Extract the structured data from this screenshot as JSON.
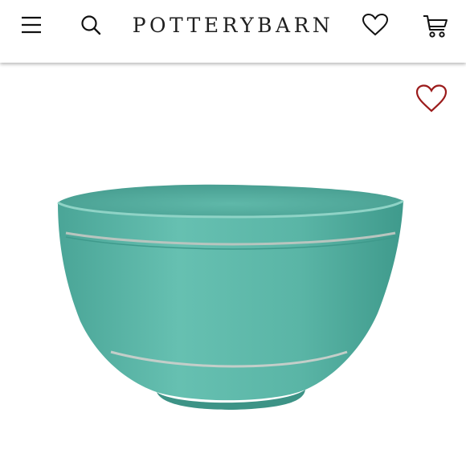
{
  "header": {
    "brand": "POTTERYBARN",
    "icons": {
      "menu": "hamburger-menu-icon",
      "search": "search-icon",
      "wishlist": "heart-outline-icon",
      "cart": "shopping-cart-icon"
    }
  },
  "product": {
    "favorite_icon": "heart-outline-icon",
    "favorite_color": "#9b1b1b",
    "bowl_color": "#5fb7a7"
  }
}
